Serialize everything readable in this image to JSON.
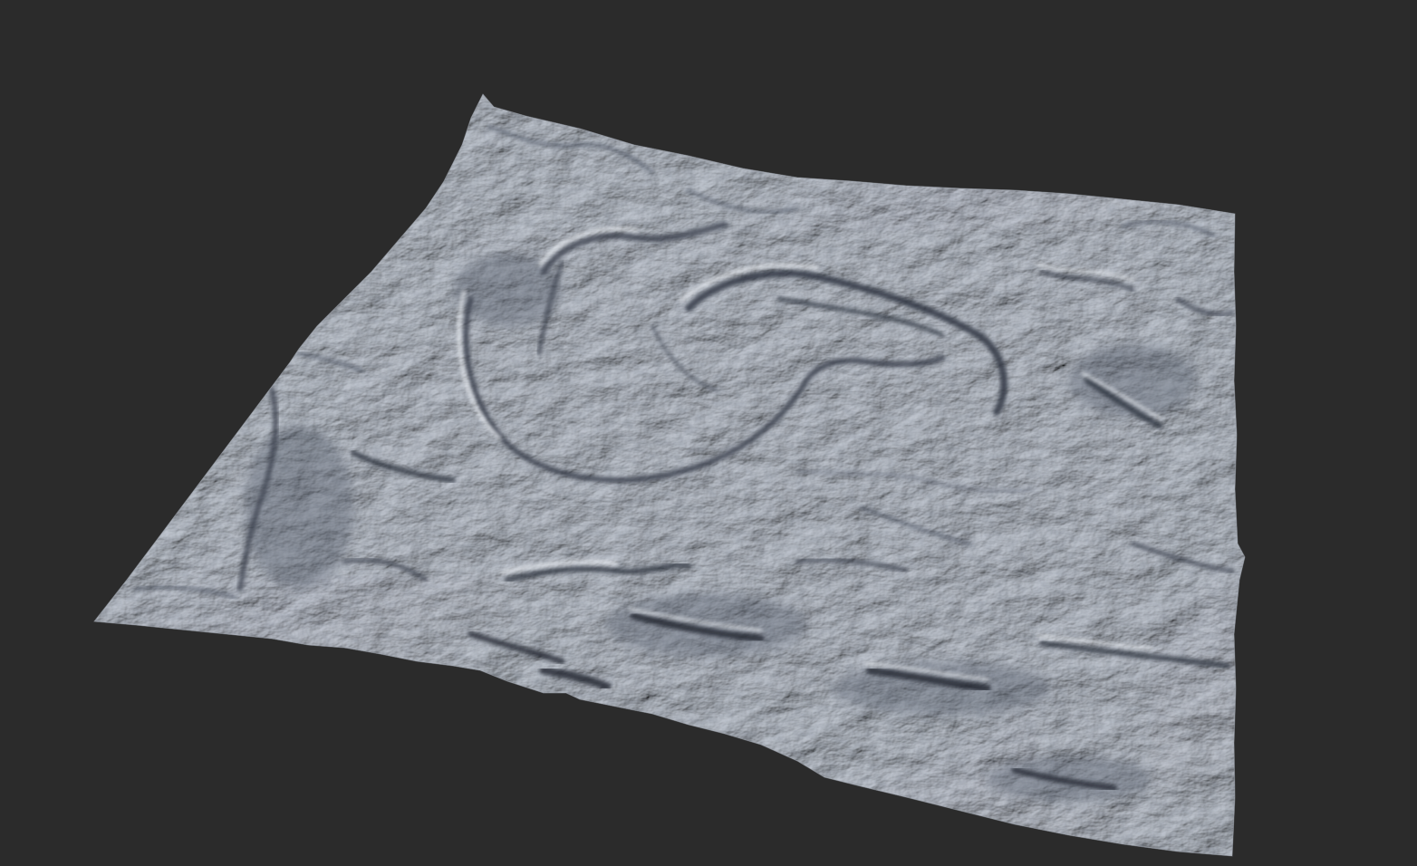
{
  "viewport": {
    "background_color": "#2b2b2b"
  },
  "terrain": {
    "surface_color": "#c9ced6",
    "highlight_color": "#e6e9ee",
    "shadow_color": "#3e4552",
    "deep_shadow_color": "#262b34"
  }
}
